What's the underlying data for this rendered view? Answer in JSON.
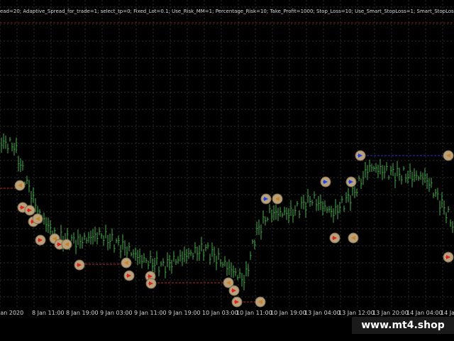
{
  "expert_params": "ead=20; Adaptive_Spread_for_trade=1; select_tp=0; Fixed_Lot=0.1; Use_Risk_MM=1; Percentage_Risk=10; Take_Profit=1000; Stop_Loss=10; Use_Smart_StopLoss=1; Smart_StopLoss",
  "time_labels": [
    "Jan 2020",
    "8 Jan 11:00",
    "8 Jan 19:00",
    "9 Jan 03:00",
    "9 Jan 11:00",
    "9 Jan 19:00",
    "10 Jan 03:00",
    "10 Jan 11:00",
    "10 Jan 19:00",
    "13 Jan 04:00",
    "13 Jan 12:00",
    "13 Jan 20:00",
    "14 Jan 04:00",
    "14 Jan"
  ],
  "watermark": "www.mt4.shop",
  "colors": {
    "background": "#000000",
    "grid": "#5a5a5a",
    "candle": "#3cb043",
    "stop_line": "#ff3030",
    "trade_line": "#4040ff",
    "marker_fill": "#b7a27c"
  }
}
